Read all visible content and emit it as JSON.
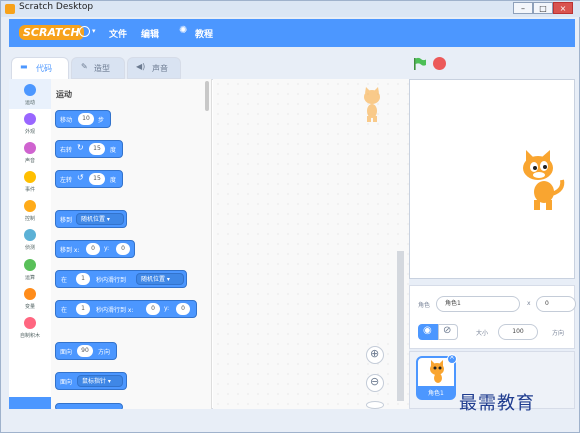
{
  "window": {
    "title": "Scratch Desktop"
  },
  "menubar": {
    "logo": "SCRATCH",
    "items": [
      "文件",
      "编辑",
      "教程"
    ]
  },
  "tabs": [
    {
      "label": "代码",
      "icon": "code-icon",
      "active": true
    },
    {
      "label": "造型",
      "icon": "brush-icon",
      "active": false
    },
    {
      "label": "声音",
      "icon": "speaker-icon",
      "active": false
    }
  ],
  "categories": [
    {
      "label": "运动",
      "color": "#4c97ff"
    },
    {
      "label": "外观",
      "color": "#9966ff"
    },
    {
      "label": "声音",
      "color": "#cf63cf"
    },
    {
      "label": "事件",
      "color": "#ffbf00"
    },
    {
      "label": "控制",
      "color": "#ffab19"
    },
    {
      "label": "侦测",
      "color": "#5cb1d6"
    },
    {
      "label": "运算",
      "color": "#59c059"
    },
    {
      "label": "变量",
      "color": "#ff8c1a"
    },
    {
      "label": "自制积木",
      "color": "#ff6680"
    }
  ],
  "palette": {
    "section_title": "运动",
    "blocks": {
      "move": {
        "pre": "移动",
        "value": "10",
        "post": "步"
      },
      "turn_right": {
        "pre": "右转",
        "value": "15",
        "post": "度"
      },
      "turn_left": {
        "pre": "左转",
        "value": "15",
        "post": "度"
      },
      "goto": {
        "pre": "移到",
        "dropdown": "随机位置"
      },
      "goto_xy": {
        "pre": "移到 x:",
        "x": "0",
        "mid": "y:",
        "y": "0"
      },
      "glide": {
        "pre": "在",
        "value": "1",
        "mid": "秒内滑行到",
        "dropdown": "随机位置"
      },
      "glide_xy": {
        "pre": "在",
        "value": "1",
        "mid": "秒内滑行到 x:",
        "x": "0",
        "ylabel": "y:",
        "y": "0"
      },
      "point_dir": {
        "pre": "面向",
        "value": "90",
        "post": "方向"
      },
      "point_towards": {
        "pre": "面向",
        "dropdown": "鼠标指针"
      }
    }
  },
  "sprite_info": {
    "sprite_label": "角色",
    "sprite_name": "角色1",
    "x_label": "x",
    "x_value": "0",
    "size_label": "大小",
    "size_value": "100",
    "direction_label": "方向"
  },
  "sprite_list": [
    {
      "name": "角色1",
      "selected": true
    }
  ],
  "watermark": "最需教育",
  "colors": {
    "accent": "#4c97ff",
    "green_flag": "#4cbf56",
    "stop": "#ec5959"
  }
}
